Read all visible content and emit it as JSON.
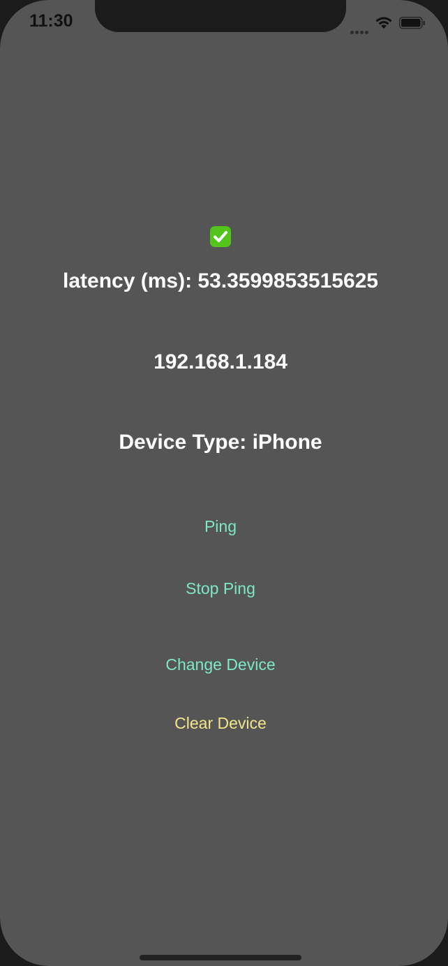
{
  "status_bar": {
    "time": "11:30"
  },
  "main": {
    "status_icon": "check-mark-icon",
    "latency_text": "latency (ms): 53.3599853515625",
    "ip_address": "192.168.1.184",
    "device_type_text": "Device Type: iPhone"
  },
  "buttons": {
    "ping": "Ping",
    "stop_ping": "Stop Ping",
    "change_device": "Change Device",
    "clear_device": "Clear Device"
  },
  "colors": {
    "background": "#555555",
    "accent_teal": "#7de8c8",
    "accent_yellow": "#f2e58c",
    "check_green": "#53c41a"
  }
}
